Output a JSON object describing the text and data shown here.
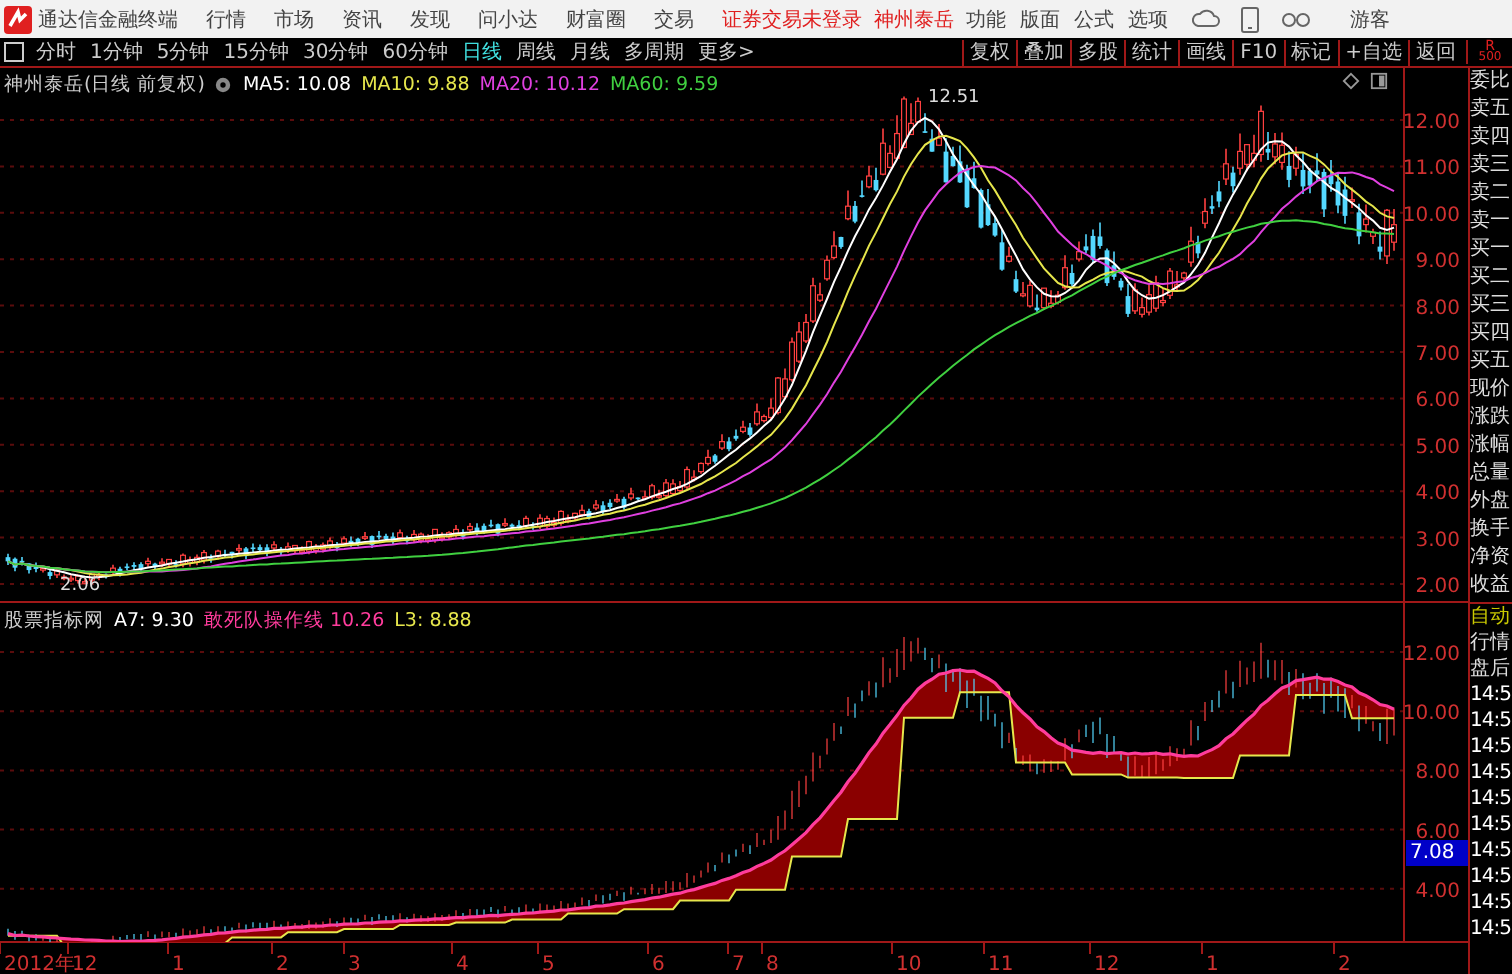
{
  "app_bar": {
    "app_name": "通达信金融终端",
    "menus": [
      "行情",
      "市场",
      "资讯",
      "发现",
      "问小达",
      "财富圈",
      "交易"
    ],
    "login_status": "证券交易未登录",
    "stock_link": "神州泰岳",
    "tools": [
      "功能",
      "版面",
      "公式",
      "选项"
    ],
    "user": "游客"
  },
  "toolbar": {
    "periods": [
      {
        "label": "分时",
        "selected": false
      },
      {
        "label": "1分钟",
        "selected": false
      },
      {
        "label": "5分钟",
        "selected": false
      },
      {
        "label": "15分钟",
        "selected": false
      },
      {
        "label": "30分钟",
        "selected": false
      },
      {
        "label": "60分钟",
        "selected": false
      },
      {
        "label": "日线",
        "selected": true
      },
      {
        "label": "周线",
        "selected": false
      },
      {
        "label": "月线",
        "selected": false
      },
      {
        "label": "多周期",
        "selected": false
      }
    ],
    "more": "更多>",
    "actions": [
      "复权",
      "叠加",
      "多股",
      "统计",
      "画线",
      "F10",
      "标记",
      "+自选",
      "返回"
    ],
    "corner_label": "R",
    "corner_value": "500"
  },
  "price_pane": {
    "title": "神州泰岳(日线 前复权)",
    "indicators": [
      {
        "label": "MA5: 10.08",
        "color": "#ffffff"
      },
      {
        "label": "MA10: 9.88",
        "color": "#e6e64c"
      },
      {
        "label": "MA20: 10.12",
        "color": "#e040e0"
      },
      {
        "label": "MA60: 9.59",
        "color": "#40d040"
      }
    ],
    "axis_labels": [
      "12.00",
      "11.00",
      "10.00",
      "9.00",
      "8.00",
      "7.00",
      "6.00",
      "5.00",
      "4.00",
      "3.00",
      "2.00"
    ],
    "high_label": "12.51",
    "low_label": "2.06"
  },
  "indicator_pane": {
    "title": "股票指标网",
    "indicators": [
      {
        "label": "A7: 9.30",
        "color": "#ffffff"
      },
      {
        "label": "敢死队操作线 10.26",
        "color": "#ff3c9c"
      },
      {
        "label": "L3: 8.88",
        "color": "#e6e64c"
      }
    ],
    "axis_labels": [
      "12.00",
      "10.00",
      "8.00",
      "6.00",
      "4.00"
    ],
    "current_price": "7.08"
  },
  "time_axis": [
    "2012年",
    "12",
    "1",
    "2",
    "3",
    "4",
    "5",
    "6",
    "7",
    "8",
    "10",
    "11",
    "12",
    "1",
    "2"
  ],
  "quote_panel": {
    "fields": [
      "委比",
      "卖五",
      "卖四",
      "卖三",
      "卖二",
      "卖一",
      "买一",
      "买二",
      "买三",
      "买四",
      "买五",
      "现价",
      "涨跌",
      "涨幅",
      "总量",
      "外盘",
      "换手",
      "净资",
      "收益"
    ],
    "modes": [
      {
        "label": "自动",
        "selected": true
      },
      {
        "label": "行情",
        "selected": false
      },
      {
        "label": "盘后",
        "selected": false
      }
    ],
    "times": [
      "14:5",
      "14:5",
      "14:5",
      "14:5",
      "14:5",
      "14:5",
      "14:5",
      "14:5",
      "14:5",
      "14:5"
    ]
  }
}
